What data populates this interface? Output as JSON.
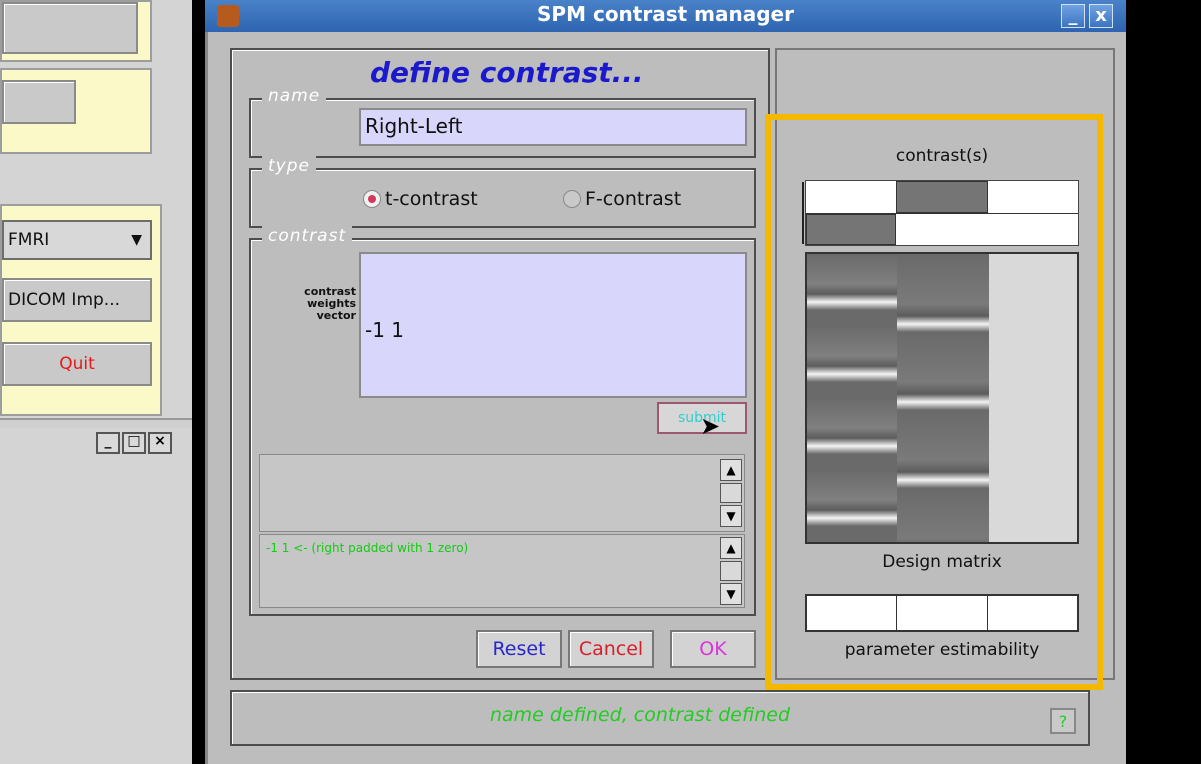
{
  "background_window": {
    "select_value": "FMRI",
    "dicom_button": "DICOM Imp...",
    "quit_button": "Quit"
  },
  "dialog": {
    "title": "SPM contrast manager",
    "minimize": "_",
    "close": "x",
    "heading": "define contrast...",
    "name_legend": "name",
    "name_value": "Right-Left",
    "type_legend": "type",
    "type_options": [
      "t-contrast",
      "F-contrast"
    ],
    "type_selected": "t-contrast",
    "contrast_legend": "contrast",
    "weights_label": [
      "contrast",
      "weights",
      "vector"
    ],
    "weights_value": "-1 1",
    "submit_button": "submit",
    "parse_message": "-1 1  <-   (right padded with 1 zero)",
    "reset_button": "Reset",
    "cancel_button": "Cancel",
    "ok_button": "OK",
    "status_text": "name defined, contrast defined",
    "help_button": "?"
  },
  "design_panel": {
    "contrasts_title": "contrast(s)",
    "design_matrix_label": "Design matrix",
    "estimability_label": "parameter estimability"
  },
  "colors": {
    "highlight_border": "#f5b800",
    "edit_bg": "#d9d6fb",
    "status_text": "#22cc22",
    "heading": "#1a1acc"
  }
}
